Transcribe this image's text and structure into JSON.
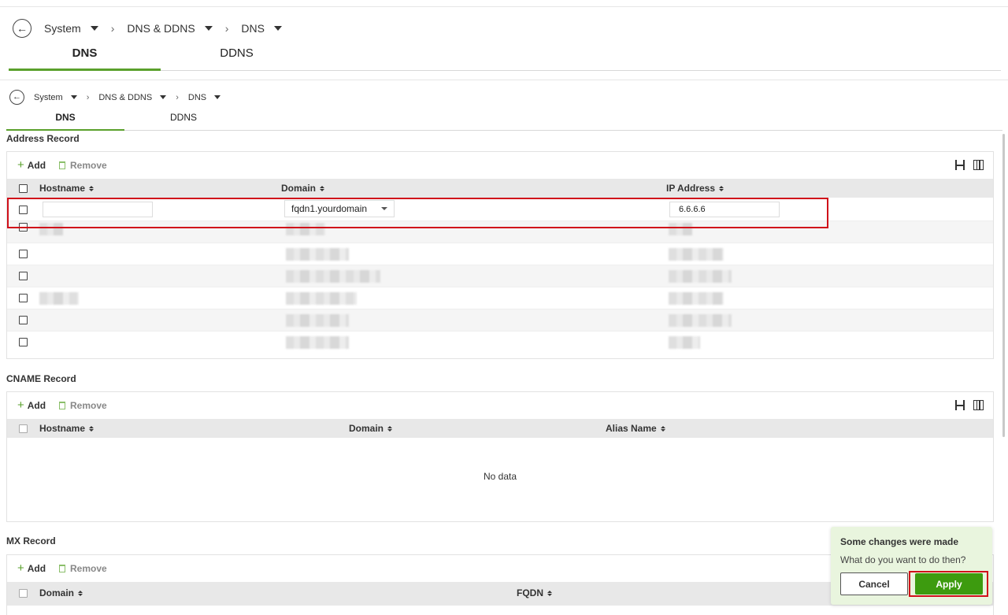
{
  "header": {
    "breadcrumb": [
      "System",
      "DNS & DDNS",
      "DNS"
    ],
    "tabs": [
      "DNS",
      "DDNS"
    ]
  },
  "main": {
    "breadcrumb": [
      "System",
      "DNS & DDNS",
      "DNS"
    ],
    "tabs": [
      "DNS",
      "DDNS"
    ]
  },
  "toolbar": {
    "add": "Add",
    "remove": "Remove"
  },
  "address_record": {
    "title": "Address Record",
    "columns": [
      "Hostname",
      "Domain",
      "IP Address"
    ],
    "edit_row": {
      "hostname": "",
      "domain": "fqdn1.yourdomain",
      "ip": "6.6.6.6"
    }
  },
  "cname_record": {
    "title": "CNAME Record",
    "columns": [
      "Hostname",
      "Domain",
      "Alias Name"
    ],
    "empty_text": "No data"
  },
  "mx_record": {
    "title": "MX Record",
    "columns": [
      "Domain",
      "FQDN"
    ]
  },
  "popup": {
    "title": "Some changes were made",
    "message": "What do you want to do then?",
    "cancel": "Cancel",
    "apply": "Apply"
  },
  "colors": {
    "accent": "#5aa02c",
    "apply": "#3d9b0f",
    "highlight": "#d0101a"
  }
}
